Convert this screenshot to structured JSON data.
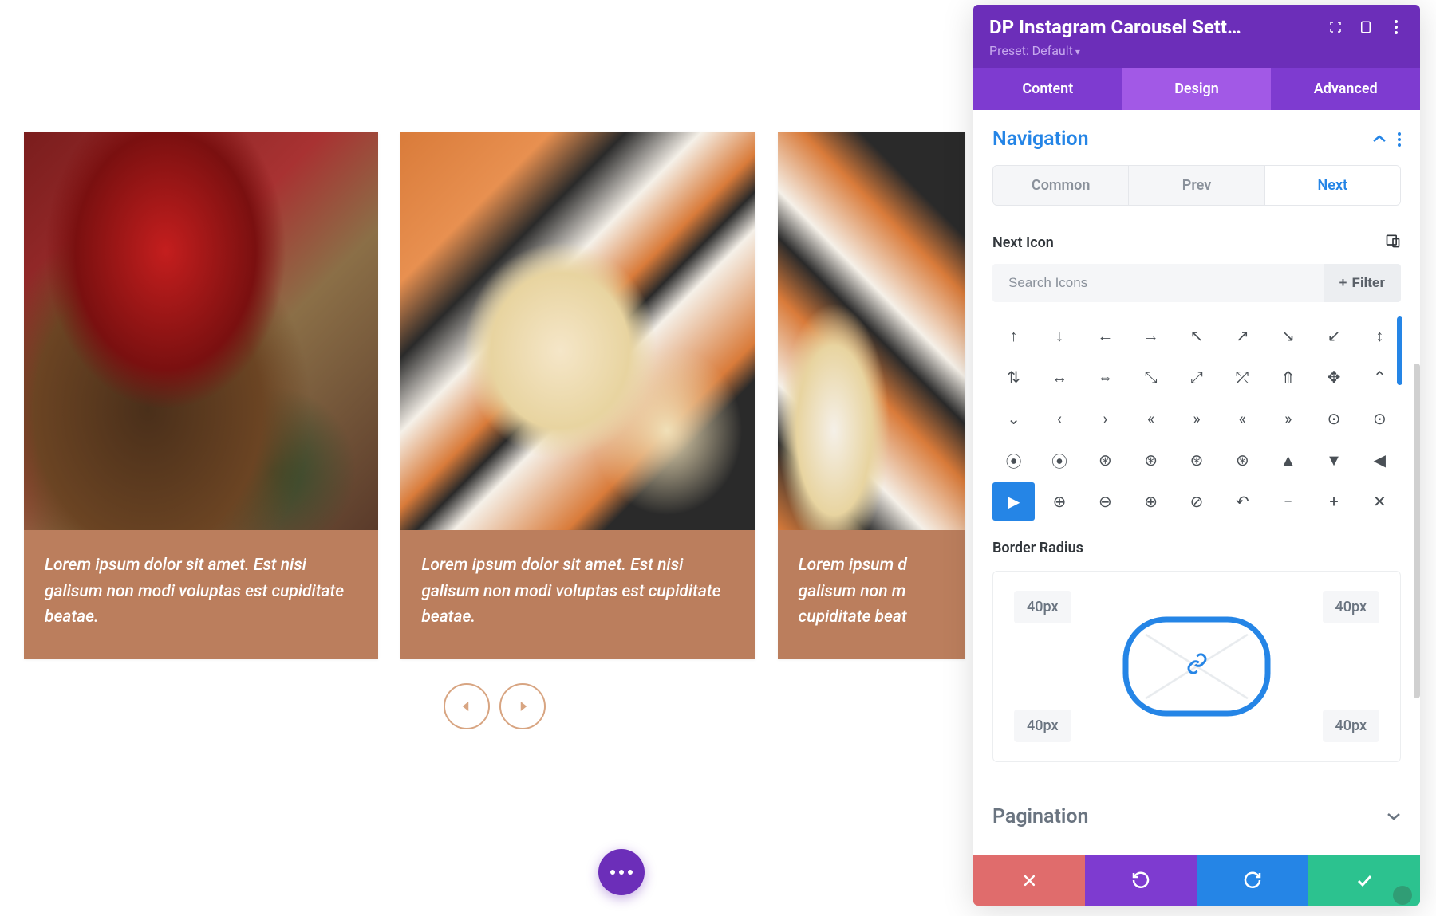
{
  "carousel": {
    "cards": [
      {
        "caption": "Lorem ipsum dolor sit amet. Est nisi galisum non modi voluptas est cupiditate beatae."
      },
      {
        "caption": "Lorem ipsum dolor sit amet. Est nisi galisum non modi voluptas est cupiditate beatae."
      },
      {
        "caption": "Lorem ipsum d\n galisum non m\n cupiditate beat"
      }
    ]
  },
  "panel": {
    "title": "DP Instagram Carousel Sett…",
    "preset_label": "Preset: Default",
    "tabs": {
      "content": "Content",
      "design": "Design",
      "advanced": "Advanced"
    },
    "active_tab": "Design",
    "sections": {
      "navigation": {
        "title": "Navigation",
        "subtabs": {
          "common": "Common",
          "prev": "Prev",
          "next": "Next"
        },
        "active_subtab": "Next",
        "next_icon_label": "Next Icon",
        "search_placeholder": "Search Icons",
        "filter_label": "Filter",
        "icons": [
          "↑",
          "↓",
          "←",
          "→",
          "↖",
          "↗",
          "↘",
          "↙",
          "↕",
          "⇅",
          "↔",
          "⇔",
          "⤡",
          "⤢",
          "⤱",
          "⤊",
          "✥",
          "⌃",
          "⌄",
          "‹",
          "›",
          "«",
          "»",
          "«",
          "»",
          "⊙",
          "⊙",
          "⦿",
          "⦿",
          "⊛",
          "⊛",
          "⊛",
          "⊛",
          "▲",
          "▼",
          "◀",
          "▶",
          "⊕",
          "⊖",
          "⊕",
          "⊘",
          "↶",
          "−",
          "+",
          "✕"
        ],
        "selected_icon_index": 36,
        "border_radius_label": "Border Radius",
        "border_radius": {
          "tl": "40px",
          "tr": "40px",
          "bl": "40px",
          "br": "40px"
        }
      },
      "pagination": {
        "title": "Pagination"
      }
    }
  }
}
